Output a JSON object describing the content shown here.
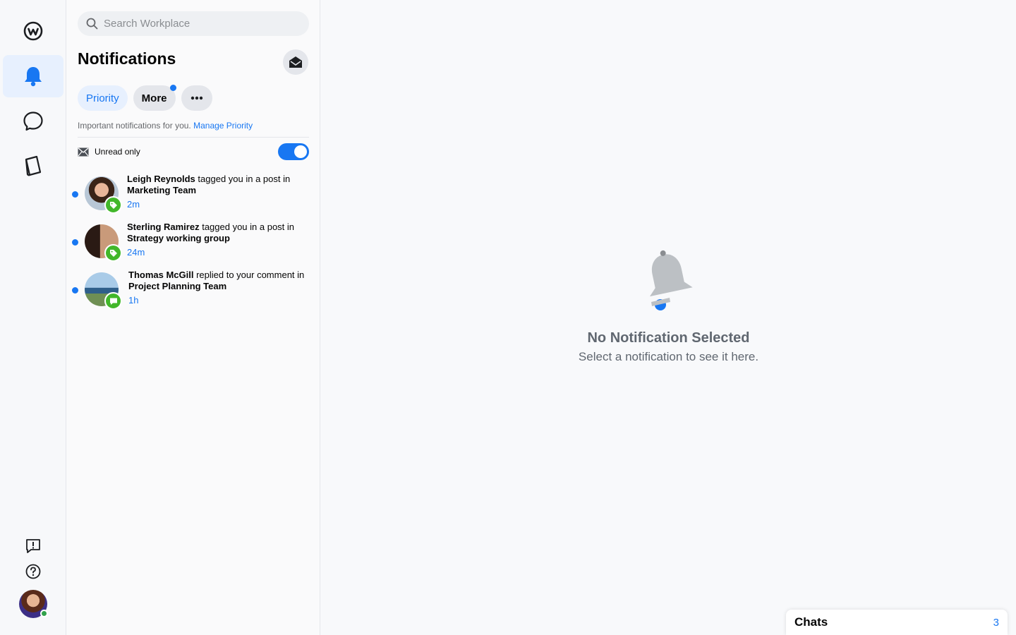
{
  "rail": {
    "items": [
      {
        "name": "workplace-logo",
        "active": false
      },
      {
        "name": "notifications",
        "active": true
      },
      {
        "name": "chat",
        "active": false
      },
      {
        "name": "knowledge-library",
        "active": false
      }
    ]
  },
  "search": {
    "placeholder": "Search Workplace"
  },
  "panel": {
    "title": "Notifications",
    "tabs": [
      {
        "label": "Priority",
        "active": true
      },
      {
        "label": "More",
        "has_dot": true
      }
    ],
    "helper_text": "Important notifications for you.",
    "helper_link": "Manage Priority",
    "unread_label": "Unread only",
    "unread_only": true
  },
  "notifications": [
    {
      "actor": "Leigh Reynolds",
      "action": " tagged you in a post in ",
      "target": "Marketing Team",
      "time": "2m",
      "badge": "tag-icon",
      "unread": true
    },
    {
      "actor": "Sterling Ramirez",
      "action": " tagged you in a post in ",
      "target": "Strategy working group",
      "time": "24m",
      "badge": "tag-icon",
      "unread": true
    },
    {
      "actor": "Thomas McGill",
      "action": " replied to your comment in ",
      "target": "Project Planning Team",
      "time": "1h",
      "badge": "comment-icon",
      "unread": true
    }
  ],
  "empty_state": {
    "title": "No Notification Selected",
    "subtitle": "Select a notification to see it here."
  },
  "chats": {
    "label": "Chats",
    "count": "3"
  },
  "colors": {
    "accent": "#1877f2",
    "badge_green": "#42b72a"
  }
}
